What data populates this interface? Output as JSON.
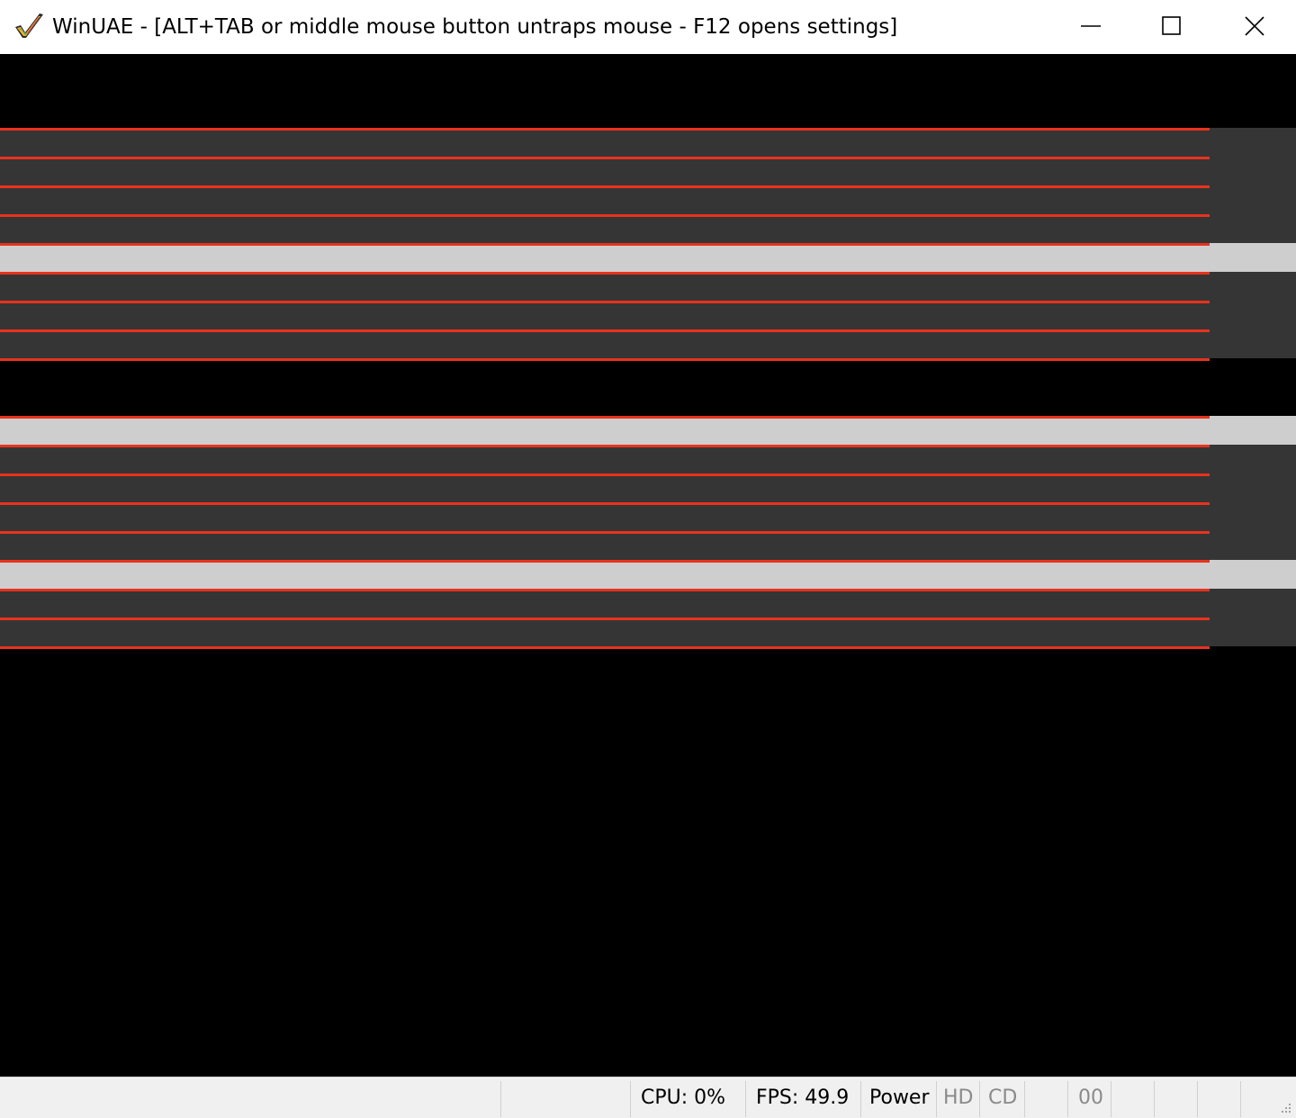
{
  "window": {
    "title": "WinUAE - [ALT+TAB or middle mouse button untraps mouse - F12 opens settings]",
    "icon": "winuae-checkmark-icon",
    "controls": [
      "minimize-icon",
      "maximize-icon",
      "close-icon"
    ]
  },
  "colors": {
    "background": "#000000",
    "stripe_dark": "#353535",
    "stripe_light": "#cfcecf",
    "stripe_line": "#e8321e",
    "titlebar": "#ffffff",
    "statusbar": "#f0f0f0"
  },
  "statusbar": {
    "cpu": "CPU: 0%",
    "fps": "FPS: 49.9",
    "power": "Power",
    "hd": "HD",
    "cd": "CD",
    "drive": "00"
  }
}
